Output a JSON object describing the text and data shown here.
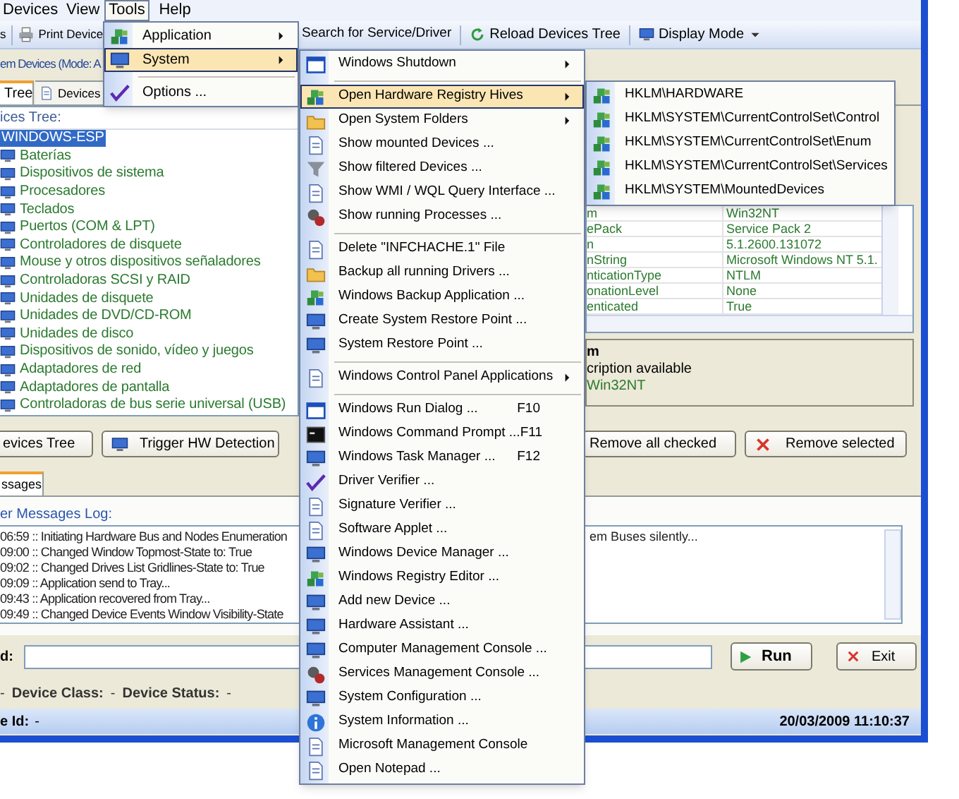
{
  "menu_bar": [
    {
      "label": "Devices",
      "selected": false
    },
    {
      "label": "View",
      "selected": false
    },
    {
      "label": "Tools",
      "selected": true
    },
    {
      "label": "Help",
      "selected": false
    }
  ],
  "toolbar": [
    {
      "label": "s"
    },
    {
      "label": "Print Device"
    },
    {
      "label": "Search for Service/Driver"
    },
    {
      "label": "Reload Devices Tree"
    },
    {
      "label": "Display Mode",
      "dropdown": true
    }
  ],
  "mode_label": "em Devices (Mode: A",
  "tabs": [
    {
      "label": "Tree",
      "selected": true
    },
    {
      "label": "Devices",
      "selected": false
    }
  ],
  "tree": {
    "header": "ices Tree:",
    "nodes": [
      {
        "label": "WINDOWS-ESP",
        "selected": true,
        "children": [
          {
            "label": "Baterías",
            "selected": false
          },
          {
            "label": "Dispositivos de sistema",
            "selected": false
          },
          {
            "label": "Procesadores",
            "selected": false
          },
          {
            "label": "Teclados",
            "selected": false
          },
          {
            "label": "Puertos (COM & LPT)",
            "selected": false
          },
          {
            "label": "Controladores de disquete",
            "selected": false
          },
          {
            "label": "Mouse y otros dispositivos señaladores",
            "selected": false
          },
          {
            "label": "Controladoras SCSI y RAID",
            "selected": false
          },
          {
            "label": "Unidades de disquete",
            "selected": false
          },
          {
            "label": "Unidades de DVD/CD-ROM",
            "selected": false
          },
          {
            "label": "Unidades de disco",
            "selected": false
          },
          {
            "label": "Dispositivos de sonido, vídeo y juegos",
            "selected": false
          },
          {
            "label": "Adaptadores de red",
            "selected": false
          },
          {
            "label": "Adaptadores de pantalla",
            "selected": false
          },
          {
            "label": "Controladoras de bus serie universal (USB)",
            "selected": false
          }
        ]
      }
    ]
  },
  "properties": [
    {
      "name": "m",
      "value": "Win32NT"
    },
    {
      "name": "ePack",
      "value": "Service Pack 2"
    },
    {
      "name": "n",
      "value": "5.1.2600.131072"
    },
    {
      "name": "nString",
      "value": "Microsoft Windows NT 5.1."
    },
    {
      "name": "nticationType",
      "value": "NTLM"
    },
    {
      "name": "onationLevel",
      "value": "None"
    },
    {
      "name": "enticated",
      "value": "True"
    }
  ],
  "description": {
    "title": "m",
    "text": "cription available",
    "value": "Win32NT"
  },
  "buttons": [
    {
      "label": "evices Tree"
    },
    {
      "label": "Trigger HW Detection"
    },
    {
      "label": "Remove all checked"
    },
    {
      "label": "Remove selected"
    }
  ],
  "bottom_tabs": [
    {
      "label": "ssages",
      "selected": true
    }
  ],
  "log": {
    "title": "er Messages Log:",
    "lines": [
      "06:59 :: Initiating Hardware Bus and Nodes Enumeration",
      "09:00 :: Changed Window Topmost-State to: True",
      "09:02 :: Changed Drives List Gridlines-State to: True",
      "09:09 :: Application send to Tray...",
      "09:43 :: Application recovered from Tray...",
      "09:49 :: Changed Device Events Window Visibility-State"
    ],
    "line_tail": "em Buses silently..."
  },
  "command": {
    "label": "d:",
    "run_button": "Run",
    "exit_button": "Exit"
  },
  "details": [
    {
      "kind": "value",
      "text": "-"
    },
    {
      "kind": "label",
      "text": "Device Class:"
    },
    {
      "kind": "value",
      "text": "-"
    },
    {
      "kind": "label",
      "text": "Device Status:"
    },
    {
      "kind": "value",
      "text": "-"
    }
  ],
  "status_bar": {
    "label": "e Id:",
    "value": "-",
    "datetime": "20/03/2009 11:10:37"
  },
  "tools_menu": [
    {
      "kind": "item",
      "label": "Application",
      "submenu": true,
      "selected": false
    },
    {
      "kind": "item",
      "label": "System",
      "submenu": true,
      "selected": true
    },
    {
      "kind": "separator"
    },
    {
      "kind": "item",
      "label": "Options ...",
      "submenu": false,
      "selected": false
    }
  ],
  "system_menu": [
    {
      "kind": "item",
      "label": "Windows Shutdown",
      "submenu": true,
      "selected": false
    },
    {
      "kind": "separator"
    },
    {
      "kind": "item",
      "label": "Open Hardware Registry Hives",
      "submenu": true,
      "selected": true
    },
    {
      "kind": "item",
      "label": "Open System Folders",
      "submenu": true,
      "selected": false
    },
    {
      "kind": "item",
      "label": "Show mounted Devices ...",
      "submenu": false,
      "selected": false
    },
    {
      "kind": "item",
      "label": "Show filtered Devices ...",
      "submenu": false,
      "selected": false
    },
    {
      "kind": "item",
      "label": "Show WMI / WQL Query Interface ...",
      "submenu": false,
      "selected": false
    },
    {
      "kind": "item",
      "label": "Show running Processes ...",
      "submenu": false,
      "selected": false
    },
    {
      "kind": "separator"
    },
    {
      "kind": "item",
      "label": "Delete \"INFCHACHE.1\"  File",
      "submenu": false,
      "selected": false
    },
    {
      "kind": "item",
      "label": "Backup all running Drivers ...",
      "submenu": false,
      "selected": false
    },
    {
      "kind": "item",
      "label": "Windows Backup Application ...",
      "submenu": false,
      "selected": false
    },
    {
      "kind": "item",
      "label": "Create System Restore Point ...",
      "submenu": false,
      "selected": false
    },
    {
      "kind": "item",
      "label": "System Restore Point ...",
      "submenu": false,
      "selected": false
    },
    {
      "kind": "separator"
    },
    {
      "kind": "item",
      "label": "Windows Control Panel Applications",
      "submenu": true,
      "selected": false
    },
    {
      "kind": "separator"
    },
    {
      "kind": "item",
      "label": "Windows Run Dialog ...",
      "shortcut": "F10",
      "submenu": false,
      "selected": false
    },
    {
      "kind": "item",
      "label": "Windows Command Prompt ...",
      "shortcut": "F11",
      "submenu": false,
      "selected": false
    },
    {
      "kind": "item",
      "label": "Windows Task Manager ...",
      "shortcut": "F12",
      "submenu": false,
      "selected": false
    },
    {
      "kind": "item",
      "label": "Driver Verifier ...",
      "submenu": false,
      "selected": false
    },
    {
      "kind": "item",
      "label": "Signature Verifier ...",
      "submenu": false,
      "selected": false
    },
    {
      "kind": "item",
      "label": "Software Applet ...",
      "submenu": false,
      "selected": false
    },
    {
      "kind": "item",
      "label": "Windows Device Manager ...",
      "submenu": false,
      "selected": false
    },
    {
      "kind": "item",
      "label": "Windows Registry Editor ...",
      "submenu": false,
      "selected": false
    },
    {
      "kind": "item",
      "label": "Add new Device ...",
      "submenu": false,
      "selected": false
    },
    {
      "kind": "item",
      "label": "Hardware Assistant ...",
      "submenu": false,
      "selected": false
    },
    {
      "kind": "item",
      "label": "Computer Management Console ...",
      "submenu": false,
      "selected": false
    },
    {
      "kind": "item",
      "label": "Services Management Console ...",
      "submenu": false,
      "selected": false
    },
    {
      "kind": "item",
      "label": "System Configuration ...",
      "submenu": false,
      "selected": false
    },
    {
      "kind": "item",
      "label": "System Information ...",
      "submenu": false,
      "selected": false
    },
    {
      "kind": "item",
      "label": "Microsoft Management Console",
      "submenu": false,
      "selected": false
    },
    {
      "kind": "item",
      "label": "Open Notepad ...",
      "submenu": false,
      "selected": false
    }
  ],
  "hives_menu": [
    {
      "kind": "item",
      "label": "HKLM\\HARDWARE",
      "submenu": false,
      "selected": false
    },
    {
      "kind": "item",
      "label": "HKLM\\SYSTEM\\CurrentControlSet\\Control",
      "submenu": false,
      "selected": false
    },
    {
      "kind": "item",
      "label": "HKLM\\SYSTEM\\CurrentControlSet\\Enum",
      "submenu": false,
      "selected": false
    },
    {
      "kind": "item",
      "label": "HKLM\\SYSTEM\\CurrentControlSet\\Services",
      "submenu": false,
      "selected": false
    },
    {
      "kind": "item",
      "label": "HKLM\\SYSTEM\\MountedDevices",
      "submenu": false,
      "selected": false
    }
  ]
}
